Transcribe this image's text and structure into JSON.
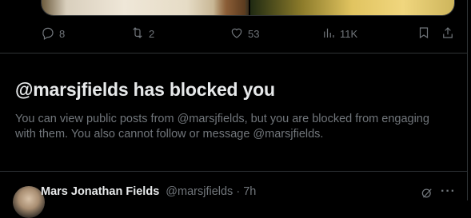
{
  "tweet_actions": {
    "replies": "8",
    "reposts": "2",
    "likes": "53",
    "views": "11K"
  },
  "blocked_notice": {
    "title": "@marsjfields has blocked you",
    "body": "You can view public posts from @marsjfields, but you are blocked from engaging with them. You also cannot follow or message @marsjfields."
  },
  "next_tweet": {
    "author_name": "Mars Jonathan Fields",
    "handle": "@marsjfields",
    "time": "· 7h",
    "more": "···"
  },
  "colors": {
    "background": "#000000",
    "primary_text": "#e7e9ea",
    "secondary_text": "#71767b",
    "border": "#2f3336"
  },
  "icons": {
    "reply": "reply-icon",
    "repost": "repost-icon",
    "like": "heart-icon",
    "views": "views-icon",
    "bookmark": "bookmark-icon",
    "share": "share-icon",
    "grok": "grok-icon"
  }
}
